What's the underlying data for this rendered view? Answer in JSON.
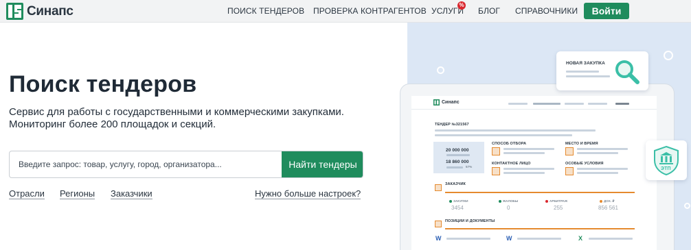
{
  "header": {
    "logo_text": "Синапс",
    "nav": [
      "ПОИСК ТЕНДЕРОВ",
      "ПРОВЕРКА КОНТРАГЕНТОВ",
      "УСЛУГИ",
      "БЛОГ",
      "СПРАВОЧНИКИ"
    ],
    "promo_badge": "%",
    "login_label": "Войти"
  },
  "main": {
    "title": "Поиск тендеров",
    "subtitle_line1": "Сервис для работы с государственными и коммерческими закупками.",
    "subtitle_line2": "Мониторинг более 200 площадок и секций.",
    "search": {
      "placeholder": "Введите запрос: товар, услугу, город, организатора...",
      "button_label": "Найти тендеры"
    },
    "links": [
      "Отрасли",
      "Регионы",
      "Заказчики"
    ],
    "more_settings": "Нужно больше настроек?"
  },
  "illustration": {
    "card_label": "НОВАЯ ЗАКУПКА",
    "etp_label": "ЭТП",
    "mini_logo": "Синапс",
    "tender_no": "ТЕНДЕР №321567",
    "price_1": "20 000 000",
    "price_2": "18 860 000",
    "price_pct": "57%",
    "selection_method": "СПОСОБ ОТБОРА",
    "place_time": "МЕСТО И ВРЕМЯ",
    "contact_person": "КОНТАКТНОЕ ЛИЦО",
    "special_conditions": "ОСОБЫЕ УСЛОВИЯ",
    "customer": "ЗАКАЗЧИК",
    "stats": [
      {
        "label": "ЗАКУПКИ",
        "value": "3454",
        "color": "#1f8c5d"
      },
      {
        "label": "ЖАЛОБЫ",
        "value": "0",
        "color": "#1f8c5d"
      },
      {
        "label": "АРБИТРАЖ",
        "value": "255",
        "color": "#d9272e"
      },
      {
        "label": "ДОХ. ₽",
        "value": "856 561",
        "color": "#e58a2e"
      }
    ],
    "positions_docs": "ПОЗИЦИИ И ДОКУМЕНТЫ",
    "doc_icons": [
      "W",
      "W",
      "X"
    ],
    "accent_green": "#1f8c5d",
    "accent_orange": "#e58a2e",
    "teal": "#3bbfa7"
  }
}
